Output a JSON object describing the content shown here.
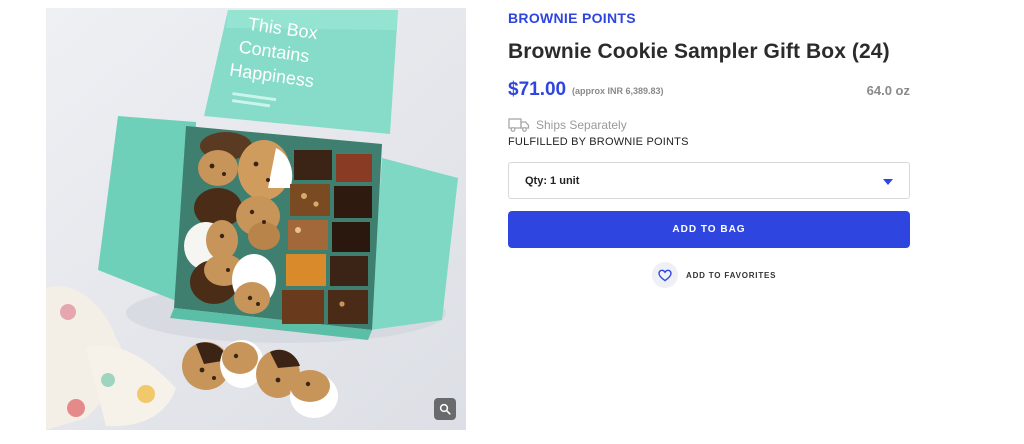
{
  "product": {
    "brand": "BROWNIE POINTS",
    "title": "Brownie Cookie Sampler Gift Box (24)",
    "price": "$71.00",
    "approx_price": "(approx INR 6,389.83)",
    "weight": "64.0 oz",
    "ships_text": "Ships Separately",
    "fulfilled_text": "FULFILLED BY BROWNIE POINTS",
    "qty_selected": "Qty: 1 unit",
    "add_to_bag_label": "ADD TO BAG",
    "favorites_label": "ADD TO FAVORITES"
  },
  "image": {
    "box_lid_text": [
      "This Box",
      "Contains",
      "Happiness"
    ],
    "icons": {
      "zoom": "magnify-icon",
      "truck": "truck-icon",
      "heart": "heart-icon",
      "dropdown": "chevron-down-icon"
    }
  },
  "colors": {
    "accent": "#2f45e0",
    "box_teal": "#7fd8c4",
    "muted_text": "#8a8a8a"
  }
}
